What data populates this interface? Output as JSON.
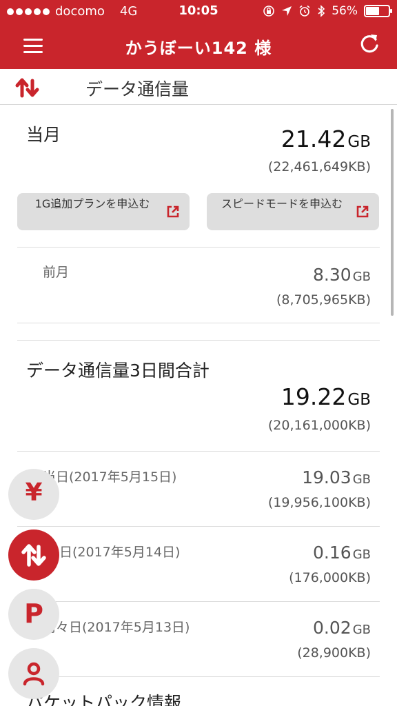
{
  "status_bar": {
    "carrier": "docomo",
    "network": "4G",
    "time": "10:05",
    "battery": "56%"
  },
  "header": {
    "title": "かうぼーい142 様",
    "menu_icon": "hamburger-icon",
    "refresh_icon": "refresh-icon"
  },
  "section": {
    "title": "データ通信量",
    "icon": "transfer-arrows-icon"
  },
  "current_month": {
    "label": "当月",
    "value": "21.42",
    "unit": "GB",
    "kb": "(22,461,649KB)"
  },
  "buttons": {
    "add_plan": "1G追加プランを申込む",
    "speed_mode": "スピードモードを申込む"
  },
  "previous_month": {
    "label": "前月",
    "value": "8.30",
    "unit": "GB",
    "kb": "(8,705,965KB)"
  },
  "three_day": {
    "label": "データ通信量3日間合計",
    "value": "19.22",
    "unit": "GB",
    "kb": "(20,161,000KB)"
  },
  "days": [
    {
      "label": "当日(2017年5月15日)",
      "value": "19.03",
      "unit": "GB",
      "kb": "(19,956,100KB)"
    },
    {
      "label": "日(2017年5月14日)",
      "value": "0.16",
      "unit": "GB",
      "kb": "(176,000KB)"
    },
    {
      "label": "前々日(2017年5月13日)",
      "value": "0.02",
      "unit": "GB",
      "kb": "(28,900KB)"
    }
  ],
  "bottom_section": {
    "title": "パケットパック情報"
  },
  "fab_buttons": {
    "yen": "¥",
    "points": "P"
  },
  "colors": {
    "brand_red": "#c9252c",
    "fab_gray": "#e6e6e6",
    "pill_gray": "#dedede"
  }
}
